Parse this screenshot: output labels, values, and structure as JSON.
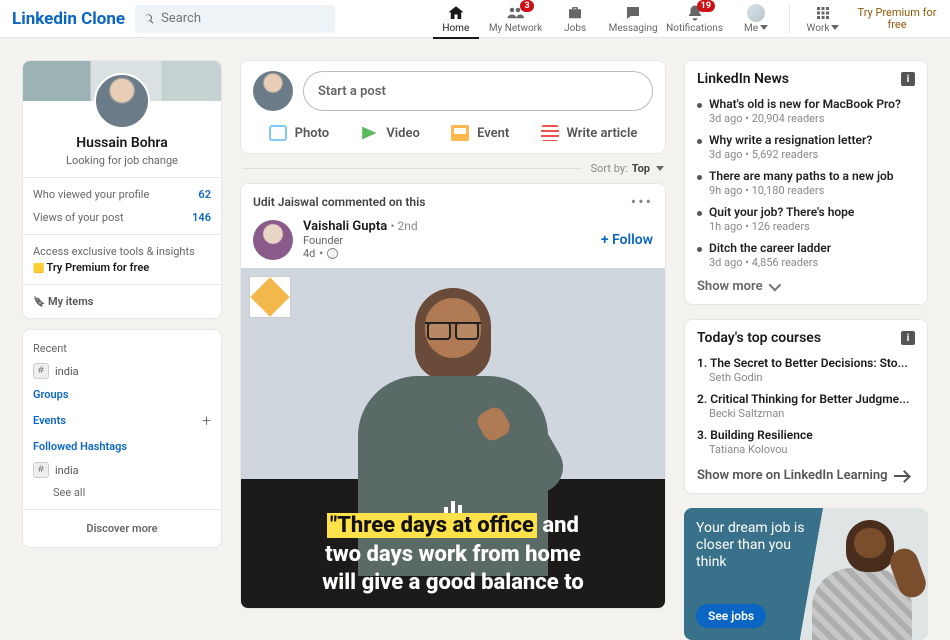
{
  "nav": {
    "brand": "Linkedin Clone",
    "search_placeholder": "Search",
    "items": [
      {
        "key": "home",
        "label": "Home",
        "active": true
      },
      {
        "key": "network",
        "label": "My Network",
        "badge": "3"
      },
      {
        "key": "jobs",
        "label": "Jobs"
      },
      {
        "key": "messaging",
        "label": "Messaging"
      },
      {
        "key": "notifications",
        "label": "Notifications",
        "badge": "19"
      },
      {
        "key": "me",
        "label": "Me"
      },
      {
        "key": "work",
        "label": "Work"
      }
    ],
    "premium": "Try Premium for free"
  },
  "profile": {
    "name": "Hussain Bohra",
    "tagline": "Looking for job change",
    "views_profile_label": "Who viewed your profile",
    "views_profile_value": "62",
    "views_post_label": "Views of your post",
    "views_post_value": "146",
    "premium_tease": "Access exclusive tools & insights",
    "premium_cta": "Try Premium for free",
    "my_items": "My items"
  },
  "side": {
    "recent": "Recent",
    "recent_items": [
      "india"
    ],
    "groups": "Groups",
    "events": "Events",
    "followed": "Followed Hashtags",
    "followed_items": [
      "india"
    ],
    "see_all": "See all",
    "discover": "Discover more"
  },
  "share": {
    "placeholder": "Start a post",
    "photo": "Photo",
    "video": "Video",
    "event": "Event",
    "article": "Write article"
  },
  "sort": {
    "label": "Sort by:",
    "value": "Top"
  },
  "post": {
    "context": "Udit Jaiswal commented on this",
    "author": "Vaishali Gupta",
    "degree": "• 2nd",
    "headline": "Founder",
    "time": "4d",
    "follow": "+ Follow",
    "quote_hl": "\"Three days at office",
    "quote_rest1": " and",
    "quote_line2": "two days work from home",
    "quote_line3": "will give a good balance to"
  },
  "news": {
    "title": "LinkedIn News",
    "items": [
      {
        "t": "What's old is new for MacBook Pro?",
        "m": "3d ago • 20,904 readers"
      },
      {
        "t": "Why write a resignation letter?",
        "m": "3d ago • 5,692 readers"
      },
      {
        "t": "There are many paths to a new job",
        "m": "9h ago • 10,180 readers"
      },
      {
        "t": "Quit your job? There's hope",
        "m": "1h ago • 126 readers"
      },
      {
        "t": "Ditch the career ladder",
        "m": "3d ago • 4,856 readers"
      }
    ],
    "show_more": "Show more"
  },
  "courses": {
    "title": "Today's top courses",
    "items": [
      {
        "t": "The Secret to Better Decisions: Sto...",
        "a": "Seth Godin"
      },
      {
        "t": "Critical Thinking for Better Judgme...",
        "a": "Becki Saltzman"
      },
      {
        "t": "Building Resilience",
        "a": "Tatiana Kolovou"
      }
    ],
    "show_more": "Show more on LinkedIn Learning"
  },
  "promo": {
    "text": "Your dream job is closer than you think",
    "cta": "See jobs"
  }
}
